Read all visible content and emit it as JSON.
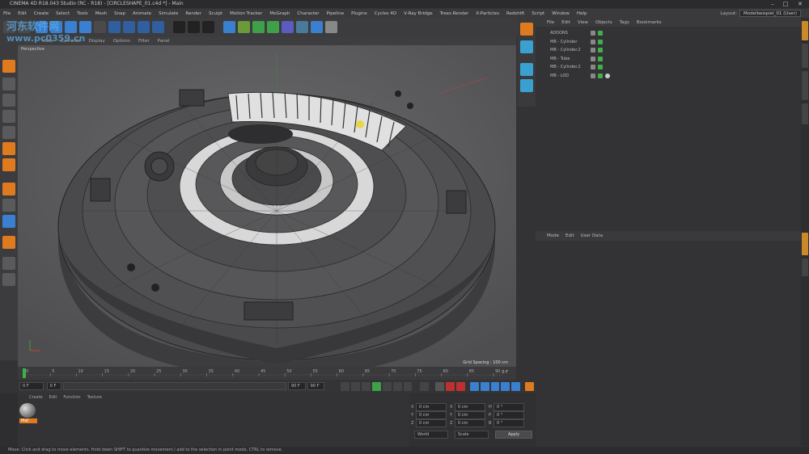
{
  "window": {
    "title": "CINEMA 4D R18.043 Studio (RC - R18) - [CIRCLESHAPE_01.c4d *] - Main"
  },
  "menu": [
    "File",
    "Edit",
    "Create",
    "Select",
    "Tools",
    "Mesh",
    "Snap",
    "Animate",
    "Simulate",
    "Render",
    "Sculpt",
    "Motion Tracker",
    "MoGraph",
    "Character",
    "Pipeline",
    "Plugins",
    "Cycles 4D",
    "V-Ray Bridge",
    "Trees Render",
    "X-Particles",
    "Redshift",
    "Script",
    "Window",
    "Help"
  ],
  "layout": {
    "label": "Layout:",
    "value": "Modelbeispiel_01 (User)"
  },
  "watermark": {
    "line1": "河东软件网",
    "line2": "www.pc0359.cn"
  },
  "viewport": {
    "menu": [
      "View",
      "Cameras",
      "Display",
      "Options",
      "Filter",
      "Panel"
    ],
    "label": "Perspective",
    "grid_spacing": "Grid Spacing : 100 cm"
  },
  "object_manager": {
    "menu": [
      "File",
      "Edit",
      "View",
      "Objects",
      "Tags",
      "Bookmarks"
    ],
    "objects": [
      {
        "name": "ADDONS"
      },
      {
        "name": "MB - Cylinder"
      },
      {
        "name": "MB - Cylinder.2"
      },
      {
        "name": "MB - Tube"
      },
      {
        "name": "MB - Cylinder.2"
      },
      {
        "name": "MB - LOD"
      }
    ]
  },
  "attribute_manager": {
    "menu": [
      "Mode",
      "Edit",
      "User Data"
    ]
  },
  "timeline": {
    "ticks": [
      "0",
      "5",
      "10",
      "15",
      "20",
      "25",
      "30",
      "35",
      "40",
      "45",
      "50",
      "55",
      "60",
      "65",
      "70",
      "75",
      "80",
      "85",
      "90"
    ],
    "end_frame": "0 F",
    "start_field": "0 F",
    "min_field": "0 F",
    "max_field": "90 F",
    "max2_field": "90 F"
  },
  "material_manager": {
    "menu": [
      "Create",
      "Edit",
      "Function",
      "Texture"
    ],
    "material": "Mat"
  },
  "coordinates": {
    "rows": [
      {
        "a": "X",
        "av": "0 cm",
        "b": "X",
        "bv": "0 cm",
        "c": "H",
        "cv": "0 °"
      },
      {
        "a": "Y",
        "av": "0 cm",
        "b": "Y",
        "bv": "0 cm",
        "c": "P",
        "cv": "0 °"
      },
      {
        "a": "Z",
        "av": "0 cm",
        "b": "Z",
        "bv": "0 cm",
        "c": "B",
        "cv": "0 °"
      }
    ],
    "mode": "World",
    "size_mode": "Scale",
    "apply": "Apply"
  },
  "status": "Move: Click and drag to move elements. Hold down SHIFT to quantize movement / add to the selection in point mode, CTRL to remove.",
  "colors": {
    "accent_blue": "#3a7fd0",
    "accent_orange": "#e07a1e",
    "viewport_bg": "#5a5a5c"
  }
}
